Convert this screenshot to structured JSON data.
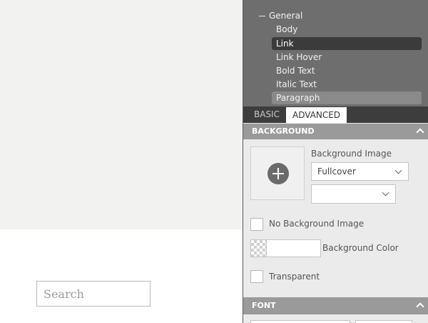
{
  "canvas": {
    "search_placeholder": "Search"
  },
  "tree": {
    "group_label": "General",
    "items": [
      {
        "label": "Body"
      },
      {
        "label": "Link"
      },
      {
        "label": "Link Hover"
      },
      {
        "label": "Bold Text"
      },
      {
        "label": "Italic Text"
      },
      {
        "label": "Paragraph"
      }
    ],
    "selected": "Link",
    "hovered": "Paragraph"
  },
  "tabs": {
    "basic": "BASIC",
    "advanced": "ADVANCED",
    "active": "ADVANCED"
  },
  "background": {
    "header": "BACKGROUND",
    "image_label": "Background Image",
    "image_mode": "Fullcover",
    "image_position": "",
    "no_image_label": "No Background Image",
    "color_label": "Background Color",
    "color_value": "",
    "transparent_label": "Transparent"
  },
  "font": {
    "header": "FONT"
  },
  "icons": {
    "add": "plus-circle-icon",
    "collapse": "chevron-up-icon",
    "dropdown": "chevron-down-icon",
    "tree_collapse": "minus-icon"
  },
  "colors": {
    "tree_bg": "#6e6e6e",
    "tree_selected": "#3b3b3b",
    "tab_bar": "#3d3d3d",
    "section_header": "#9a9a9a",
    "panel_bg": "#ebebeb",
    "canvas_bg": "#f2f2f1"
  }
}
